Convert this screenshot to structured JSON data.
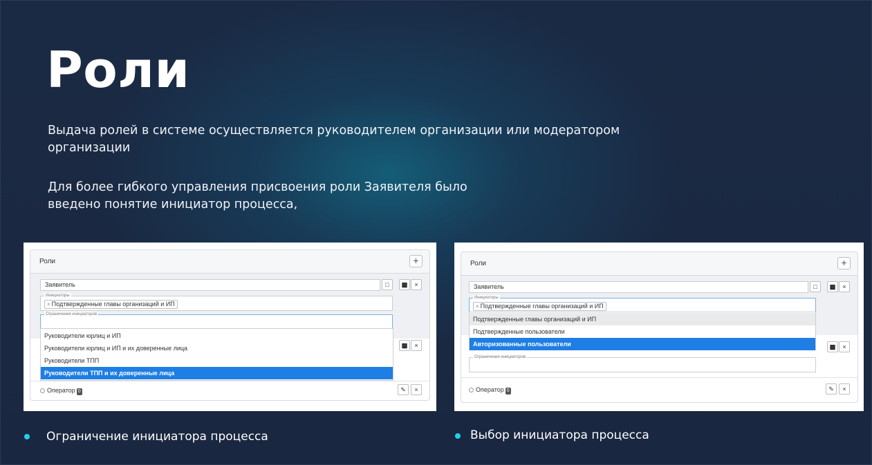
{
  "title": "Роли",
  "paragraph1": "Выдача ролей в системе осуществляется руководителем организации или модератором организации",
  "paragraph2": "Для более гибкого управления присвоения роли Заявителя было введено понятие инициатор процесса,",
  "colors": {
    "background": "#1b2840",
    "bullet": "#1fd0e8",
    "highlight": "#1e7ee4"
  },
  "screenshot_left": {
    "card_title": "Роли",
    "plus_label": "+",
    "role_name": "Заявитель",
    "initiators_legend": "Инициаторы",
    "initiator_tag": "Подтвержденные главы организаций и ИП",
    "tag_remove": "×",
    "restrictions_legend": "Ограничения инициаторов",
    "options": [
      "Руководители юрлиц и ИП",
      "Руководители юрлиц и ИП и их доверенные лица",
      "Руководители ТПП",
      "Руководители ТПП и их доверенные лица"
    ],
    "operator_label": "Оператор",
    "operator_badge": "0",
    "icons": {
      "comment": "comment-icon",
      "save": "save-icon",
      "close": "close-icon",
      "edit": "edit-icon"
    }
  },
  "screenshot_right": {
    "card_title": "Роли",
    "plus_label": "+",
    "role_name": "Заявитель",
    "initiators_legend": "Инициаторы",
    "initiator_tag": "Подтвержденные главы организаций и ИП",
    "tag_remove": "×",
    "options": [
      "Подтвержденные главы организаций и ИП",
      "Подтвержденные пользователи",
      "Авторизованные пользователи"
    ],
    "restrictions_legend": "Ограничения инициаторов",
    "operator_label": "Оператор",
    "operator_badge": "0"
  },
  "bullets": [
    "Ограничение инициатора процесса",
    "Выбор инициатора процесса"
  ]
}
